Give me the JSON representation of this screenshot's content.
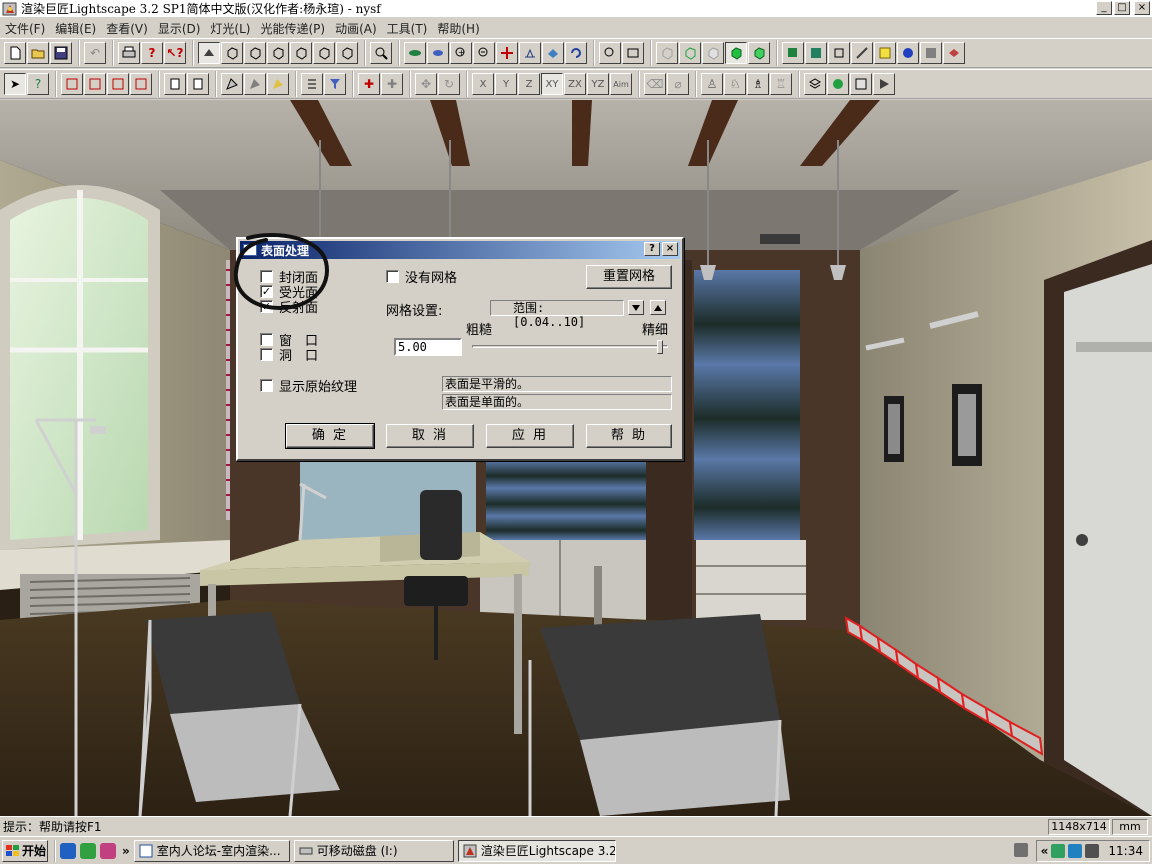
{
  "window": {
    "title": "渲染巨匠Lightscape 3.2 SP1简体中文版(汉化作者:杨永瑄) - nysf",
    "min_glyph": "_",
    "max_glyph": "□",
    "close_glyph": "×"
  },
  "menu": [
    {
      "label": "文件(F)"
    },
    {
      "label": "编辑(E)"
    },
    {
      "label": "查看(V)"
    },
    {
      "label": "显示(D)"
    },
    {
      "label": "灯光(L)"
    },
    {
      "label": "光能传递(P)"
    },
    {
      "label": "动画(A)"
    },
    {
      "label": "工具(T)"
    },
    {
      "label": "帮助(H)"
    }
  ],
  "toolbar_axes": {
    "x": "X",
    "y": "Y",
    "z": "Z",
    "xy": "XY",
    "zx": "ZX",
    "yz": "YZ",
    "aim": "Aim"
  },
  "dialog": {
    "title": "表面处理",
    "help_glyph": "?",
    "close_glyph": "×",
    "checkboxes": {
      "closed_surface": {
        "label": "封闭面",
        "checked": false,
        "mark": ""
      },
      "receive_light": {
        "label": "受光面",
        "checked": true,
        "mark": "✓"
      },
      "reflect": {
        "label": "反射面",
        "checked": true,
        "mark": "✓"
      },
      "window": {
        "label": "窗　口",
        "checked": false,
        "mark": ""
      },
      "opening": {
        "label": "洞　口",
        "checked": false,
        "mark": ""
      },
      "show_texture": {
        "label": "显示原始纹理",
        "checked": false,
        "mark": ""
      },
      "no_mesh": {
        "label": "没有网格",
        "checked": false,
        "mark": ""
      }
    },
    "reset_mesh_label": "重置网格",
    "mesh_settings_label": "网格设置:",
    "range_text": "范围: [0.04..10]",
    "coarse_label": "粗糙",
    "fine_label": "精细",
    "mesh_value": "5.00",
    "slider_fraction": 0.96,
    "info_smooth": "表面是平滑的。",
    "info_single": "表面是单面的。",
    "ok_label": "确 定",
    "cancel_label": "取 消",
    "apply_label": "应 用",
    "help_label": "帮 助"
  },
  "status": {
    "hint": "提示：帮助请按F1",
    "size": "1148x714",
    "unit": "mm"
  },
  "taskbar": {
    "start_label": "开始",
    "chevron": "»",
    "tasks": [
      {
        "label": "室内人论坛-室内渲染...",
        "active": false
      },
      {
        "label": "可移动磁盘 (I:)",
        "active": false
      },
      {
        "label": "渲染巨匠Lightscape 3.2...",
        "active": true
      }
    ],
    "tray_chevron": "«",
    "clock": "11:34"
  },
  "colors": {
    "dialog_title_start": "#0a246a",
    "dialog_title_end": "#a6caf0",
    "highlight_red": "#e02020",
    "annotation_ink": "#111111"
  }
}
